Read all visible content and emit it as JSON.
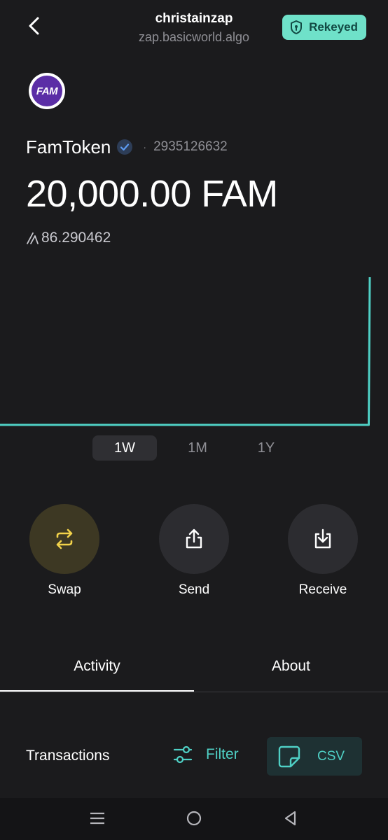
{
  "header": {
    "account_name": "christainzap",
    "account_domain": "zap.basicworld.algo",
    "rekeyed_label": "Rekeyed"
  },
  "asset": {
    "logo_text": "FAM",
    "name": "FamToken",
    "separator": "·",
    "id": "2935126632",
    "balance": "20,000.00 FAM",
    "algo_value": "86.290462"
  },
  "chart_data": {
    "type": "line",
    "x": [
      0,
      1,
      2,
      3,
      4,
      5,
      6,
      6.98,
      7
    ],
    "values": [
      0,
      0,
      0,
      0,
      0,
      0,
      0,
      0,
      86.290462
    ],
    "color": "#4fd0c5"
  },
  "periods": [
    "1W",
    "1M",
    "1Y"
  ],
  "selected_period": "1W",
  "actions": {
    "swap": "Swap",
    "send": "Send",
    "receive": "Receive"
  },
  "tabs": {
    "activity": "Activity",
    "about": "About",
    "active": "Activity"
  },
  "transactions": {
    "title": "Transactions",
    "filter_label": "Filter",
    "csv_label": "CSV"
  },
  "colors": {
    "accent": "#4fd0c5",
    "rekeyed_bg": "#6fe1c9",
    "swap_icon": "#f2d24a"
  }
}
